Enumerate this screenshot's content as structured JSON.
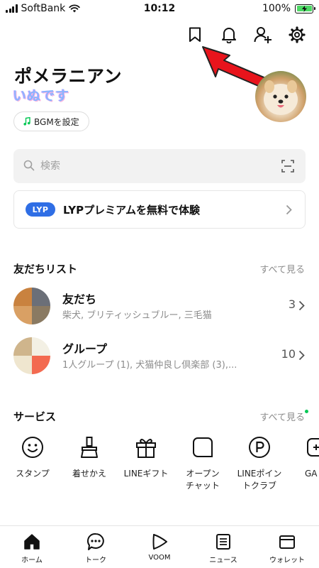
{
  "status_bar": {
    "carrier": "SoftBank",
    "time": "10:12",
    "battery": "100%",
    "battery_level": 1.0
  },
  "header": {
    "icons": [
      "bookmark-icon",
      "bell-icon",
      "add-friend-icon",
      "gear-icon"
    ],
    "annotation_color": "#e8141c"
  },
  "profile": {
    "name": "ポメラニアン",
    "status_message": "いぬです",
    "bgm_label": "BGMを設定"
  },
  "search": {
    "placeholder": "検索"
  },
  "premium_banner": {
    "logo": "LYP",
    "text": "LYPプレミアムを無料で体験"
  },
  "friends_section": {
    "title": "友だちリスト",
    "see_all": "すべて見る",
    "rows": [
      {
        "title": "友だち",
        "subtitle": "柴犬, ブリティッシュブルー, 三毛猫",
        "count": "3"
      },
      {
        "title": "グループ",
        "subtitle": "1人グループ (1), 犬猫仲良し倶楽部 (3),...",
        "count": "10"
      }
    ]
  },
  "services_section": {
    "title": "サービス",
    "see_all": "すべて見る",
    "items": [
      {
        "label": "スタンプ",
        "icon": "smiley-icon"
      },
      {
        "label": "着せかえ",
        "icon": "brush-icon"
      },
      {
        "label": "LINEギフト",
        "icon": "gift-icon"
      },
      {
        "label": "オープン\nチャット",
        "icon": "open-chat-icon"
      },
      {
        "label": "LINEポイン\nトクラブ",
        "icon": "points-icon"
      },
      {
        "label": "GA",
        "icon": "game-icon"
      }
    ]
  },
  "tab_bar": {
    "tabs": [
      {
        "label": "ホーム",
        "icon": "home-icon"
      },
      {
        "label": "トーク",
        "icon": "chat-icon"
      },
      {
        "label": "VOOM",
        "icon": "voom-icon"
      },
      {
        "label": "ニュース",
        "icon": "news-icon"
      },
      {
        "label": "ウォレット",
        "icon": "wallet-icon"
      }
    ]
  },
  "colors": {
    "accent_green": "#06c755",
    "lyp_blue": "#2f6ee5",
    "arrow_red": "#e8141c"
  }
}
